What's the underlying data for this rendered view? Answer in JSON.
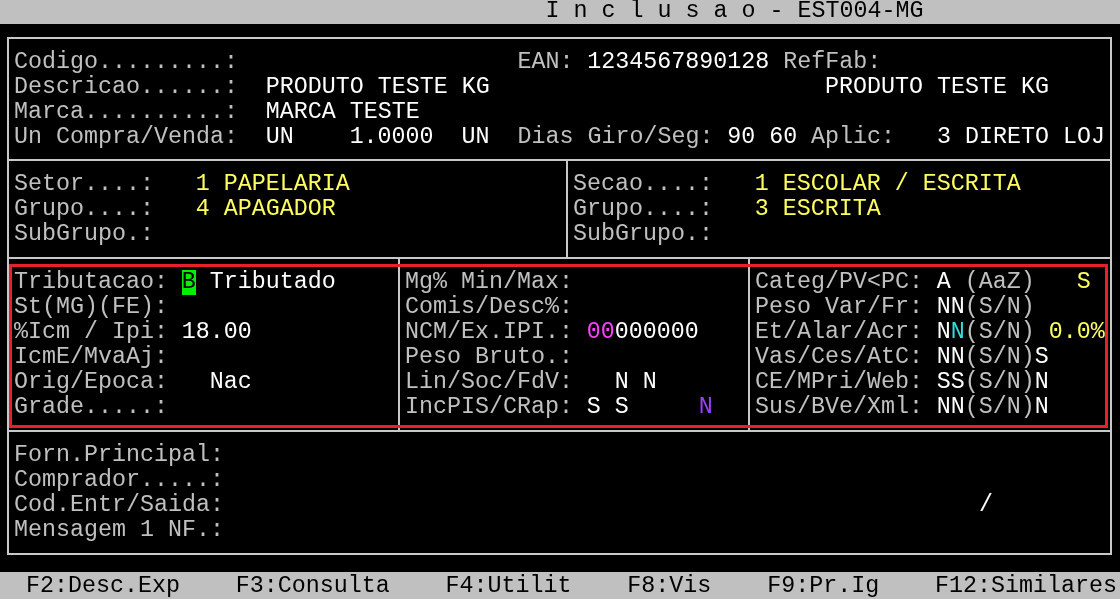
{
  "title_bar": {
    "title": "I n c l u s a o - EST004-MG"
  },
  "panels": [
    {
      "columns": [
        {
          "lines": [
            [
              {
                "text": "Codigo.........:",
                "kind": "label"
              },
              {
                "text": "EAN:",
                "kind": "label"
              },
              {
                "text": "1234567890128",
                "kind": "value"
              },
              {
                "text": "RefFab:",
                "kind": "label"
              }
            ],
            [
              {
                "text": "Descricao......:",
                "kind": "label"
              },
              {
                "text": "PRODUTO TESTE KG",
                "kind": "value"
              },
              {
                "text": "PRODUTO TESTE KG",
                "kind": "value"
              }
            ],
            [
              {
                "text": "Marca..........:",
                "kind": "label"
              },
              {
                "text": "MARCA TESTE",
                "kind": "value"
              }
            ],
            [
              {
                "text": "Un Compra/Venda:",
                "kind": "label"
              },
              {
                "text": "UN",
                "kind": "value"
              },
              {
                "text": "1.0000",
                "kind": "value"
              },
              {
                "text": "UN",
                "kind": "value"
              },
              {
                "text": "Dias Giro/Seg:",
                "kind": "label"
              },
              {
                "text": "90",
                "kind": "value"
              },
              {
                "text": "60",
                "kind": "value"
              },
              {
                "text": "Aplic:",
                "kind": "label"
              },
              {
                "text": "3 DIRETO LOJ",
                "kind": "value"
              }
            ]
          ]
        }
      ]
    },
    {
      "columns": [
        {
          "lines": [
            [
              {
                "text": "Setor....:",
                "kind": "label"
              },
              {
                "text": "1",
                "kind": "emphasis"
              },
              {
                "text": "PAPELARIA",
                "kind": "emphasis"
              }
            ],
            [
              {
                "text": "Grupo....:",
                "kind": "label"
              },
              {
                "text": "4",
                "kind": "emphasis"
              },
              {
                "text": "APAGADOR",
                "kind": "emphasis"
              }
            ],
            [
              {
                "text": "SubGrupo.:",
                "kind": "label"
              }
            ]
          ]
        },
        {
          "lines": [
            [
              {
                "text": "Secao....:",
                "kind": "label"
              },
              {
                "text": "1",
                "kind": "emphasis"
              },
              {
                "text": "ESCOLAR / ESCRITA",
                "kind": "emphasis"
              }
            ],
            [
              {
                "text": "Grupo....:",
                "kind": "label"
              },
              {
                "text": "3",
                "kind": "emphasis"
              },
              {
                "text": "ESCRITA",
                "kind": "emphasis"
              }
            ],
            [
              {
                "text": "SubGrupo.:",
                "kind": "label"
              }
            ]
          ]
        }
      ]
    },
    {
      "highlighted": true,
      "columns": [
        {
          "lines": [
            [
              {
                "text": "Tributacao:",
                "kind": "label"
              },
              {
                "text": "B",
                "kind": "cursor"
              },
              {
                "text": "Tributado",
                "kind": "value"
              }
            ],
            [
              {
                "text": "St(MG)(FE):",
                "kind": "label"
              }
            ],
            [
              {
                "text": "%Icm / Ipi:",
                "kind": "label"
              },
              {
                "text": "18.00",
                "kind": "value"
              }
            ],
            [
              {
                "text": "IcmE/MvaAj:",
                "kind": "label"
              }
            ],
            [
              {
                "text": "Orig/Epoca:",
                "kind": "label"
              },
              {
                "text": "Nac",
                "kind": "value"
              }
            ],
            [
              {
                "text": "Grade.....:",
                "kind": "label"
              }
            ]
          ]
        },
        {
          "lines": [
            [
              {
                "text": "Mg% Min/Max:",
                "kind": "label"
              }
            ],
            [
              {
                "text": "Comis/Desc%:",
                "kind": "label"
              }
            ],
            [
              {
                "text": "NCM/Ex.IPI.:",
                "kind": "label"
              },
              {
                "text": "00",
                "kind": "code"
              },
              {
                "text": "000000",
                "kind": "value"
              }
            ],
            [
              {
                "text": "Peso Bruto.:",
                "kind": "label"
              }
            ],
            [
              {
                "text": "Lin/Soc/FdV:",
                "kind": "label"
              },
              {
                "text": "N",
                "kind": "value"
              },
              {
                "text": "N",
                "kind": "value"
              }
            ],
            [
              {
                "text": "IncPIS/CRap:",
                "kind": "label"
              },
              {
                "text": "S",
                "kind": "value"
              },
              {
                "text": "S",
                "kind": "value"
              },
              {
                "text": "N",
                "kind": "option"
              }
            ]
          ]
        },
        {
          "lines": [
            [
              {
                "text": "Categ/PV<PC:",
                "kind": "label"
              },
              {
                "text": "A",
                "kind": "value"
              },
              {
                "text": "(AaZ)",
                "kind": "label"
              },
              {
                "text": "S",
                "kind": "emphasis"
              }
            ],
            [
              {
                "text": "Peso Var/Fr:",
                "kind": "label"
              },
              {
                "text": "NN",
                "kind": "value"
              },
              {
                "text": "(S/N)",
                "kind": "label"
              }
            ],
            [
              {
                "text": "Et/Alar/Acr:",
                "kind": "label"
              },
              {
                "text": "N",
                "kind": "value"
              },
              {
                "text": "N",
                "kind": "alt"
              },
              {
                "text": "(S/N)",
                "kind": "label"
              },
              {
                "text": "0.0%",
                "kind": "emphasis"
              }
            ],
            [
              {
                "text": "Vas/Ces/AtC:",
                "kind": "label"
              },
              {
                "text": "NN",
                "kind": "value"
              },
              {
                "text": "(S/N)",
                "kind": "label"
              },
              {
                "text": "S",
                "kind": "value"
              }
            ],
            [
              {
                "text": "CE/MPri/Web:",
                "kind": "label"
              },
              {
                "text": "SS",
                "kind": "value"
              },
              {
                "text": "(S/N)",
                "kind": "label"
              },
              {
                "text": "N",
                "kind": "value"
              }
            ],
            [
              {
                "text": "Sus/BVe/Xml:",
                "kind": "label"
              },
              {
                "text": "NN",
                "kind": "value"
              },
              {
                "text": "(S/N)",
                "kind": "label"
              },
              {
                "text": "N",
                "kind": "value"
              }
            ]
          ]
        }
      ]
    },
    {
      "columns": [
        {
          "lines": [
            [
              {
                "text": "Forn.Principal:",
                "kind": "label"
              }
            ],
            [
              {
                "text": "Comprador.....:",
                "kind": "label"
              }
            ],
            [
              {
                "text": "Cod.Entr/Saida:",
                "kind": "label"
              },
              {
                "text": "/",
                "kind": "value"
              }
            ],
            [
              {
                "text": "Mensagem 1 NF.:",
                "kind": "label"
              }
            ]
          ]
        }
      ]
    }
  ],
  "function_keys": [
    "F2:Desc.Exp",
    "F3:Consulta",
    "F4:Utilit",
    "F8:Vis",
    "F9:Pr.Ig",
    "F12:Similares"
  ]
}
